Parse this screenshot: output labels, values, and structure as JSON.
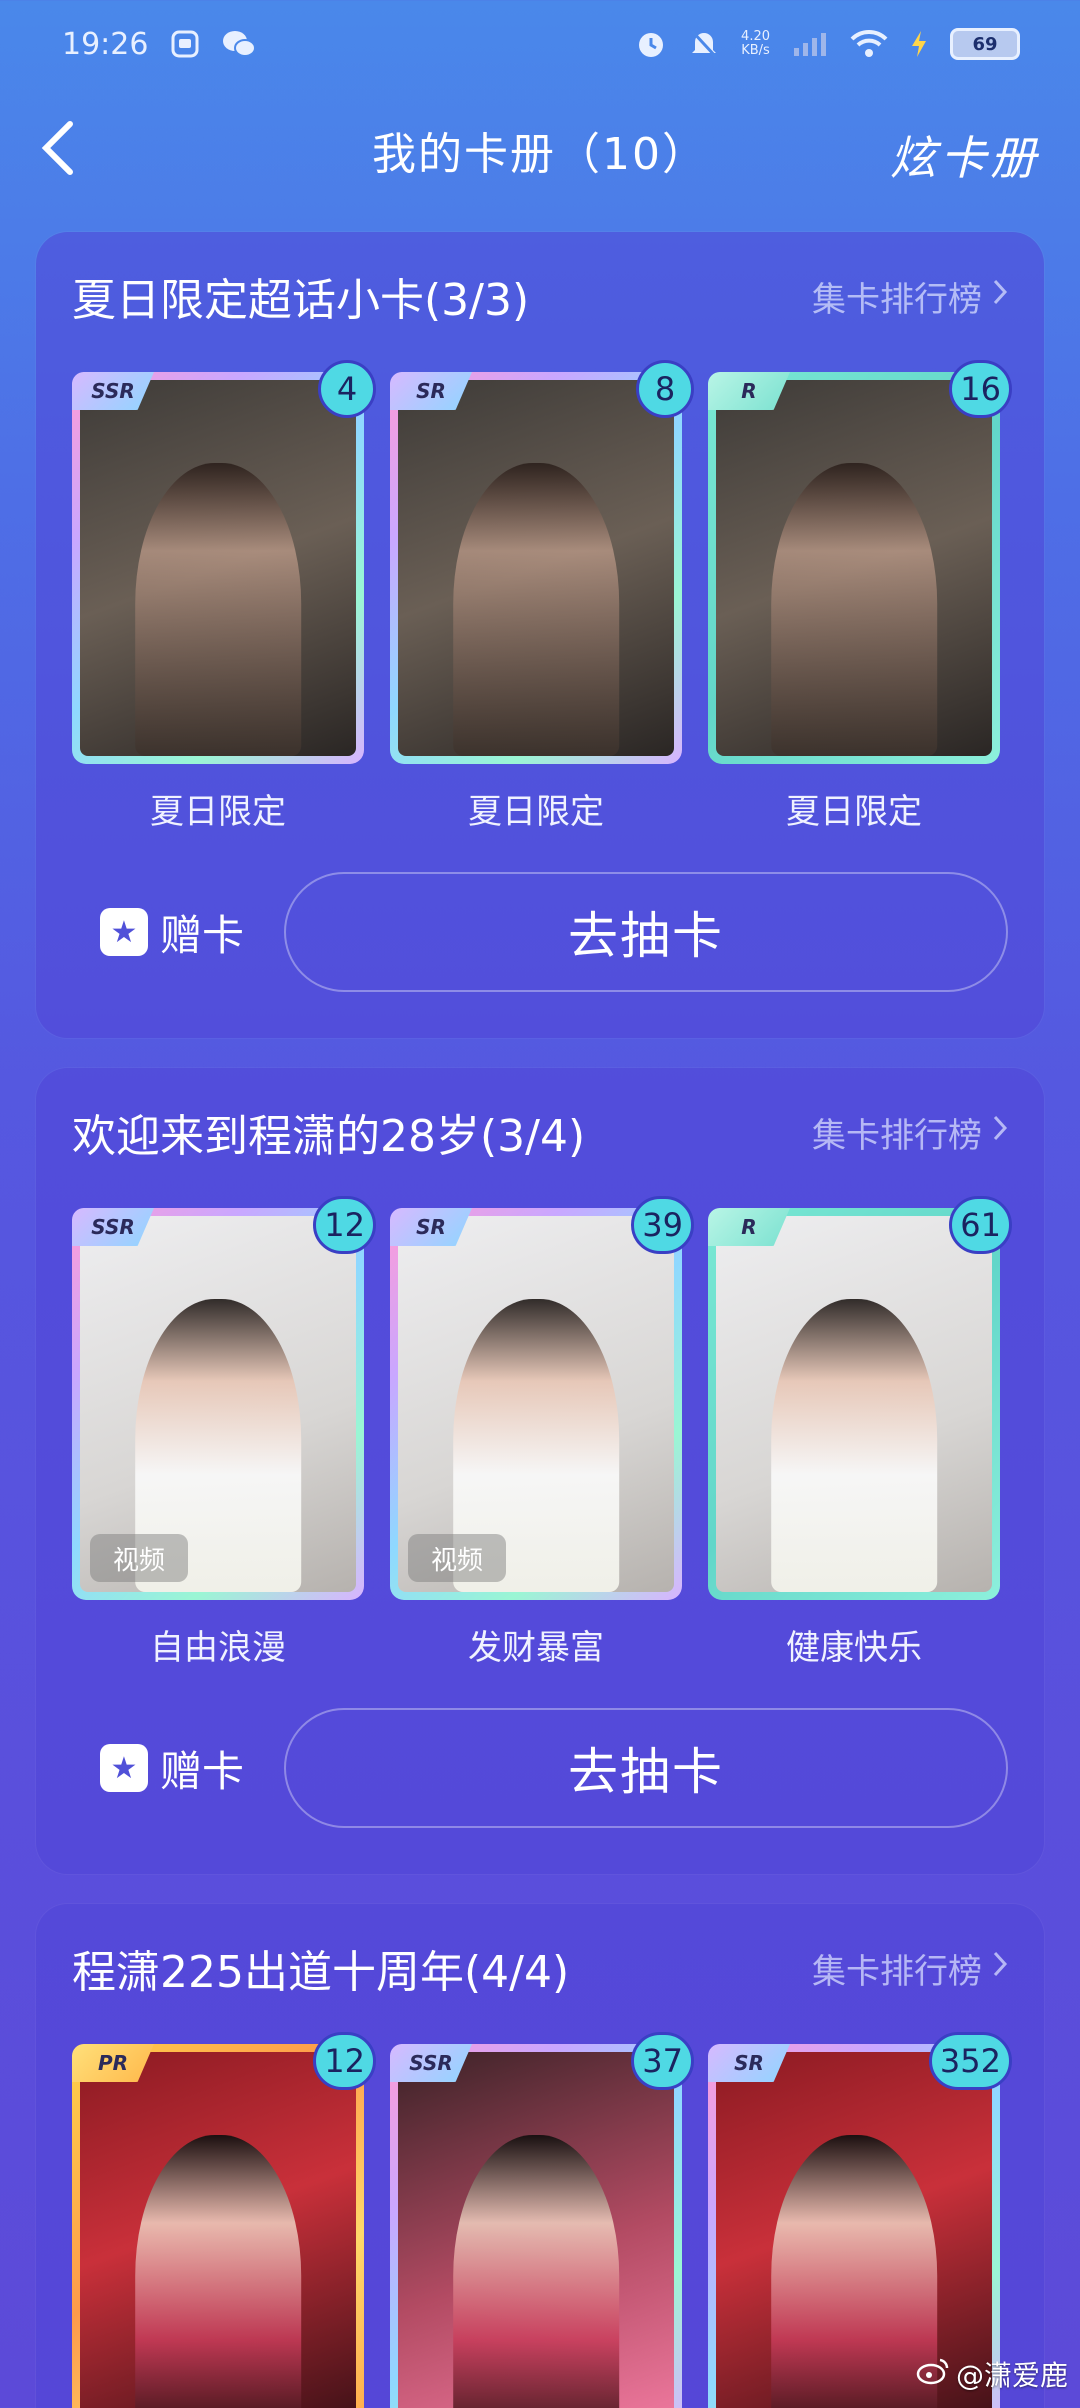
{
  "status_bar": {
    "time": "19:26",
    "net_speed_value": "4.20",
    "net_speed_unit": "KB/s",
    "battery": "69"
  },
  "nav": {
    "title": "我的卡册（10）",
    "action": "炫卡册"
  },
  "sections": [
    {
      "title": "夏日限定超话小卡(3/3)",
      "rank_label": "集卡排行榜",
      "cards": [
        {
          "rarity": "SSR",
          "count": "4",
          "label": "夏日限定"
        },
        {
          "rarity": "SR",
          "count": "8",
          "label": "夏日限定"
        },
        {
          "rarity": "R",
          "count": "16",
          "label": "夏日限定"
        }
      ],
      "gift_label": "赠卡",
      "draw_label": "去抽卡"
    },
    {
      "title": "欢迎来到程潇的28岁(3/4)",
      "rank_label": "集卡排行榜",
      "cards": [
        {
          "rarity": "SSR",
          "count": "12",
          "label": "自由浪漫",
          "video": "视频"
        },
        {
          "rarity": "SR",
          "count": "39",
          "label": "发财暴富",
          "video": "视频"
        },
        {
          "rarity": "R",
          "count": "61",
          "label": "健康快乐"
        }
      ],
      "gift_label": "赠卡",
      "draw_label": "去抽卡"
    },
    {
      "title": "程潇225出道十周年(4/4)",
      "rank_label": "集卡排行榜",
      "cards": [
        {
          "rarity": "PR",
          "count": "12"
        },
        {
          "rarity": "SSR",
          "count": "37"
        },
        {
          "rarity": "SR",
          "count": "352"
        }
      ]
    }
  ],
  "watermark": "@潇爱鹿"
}
